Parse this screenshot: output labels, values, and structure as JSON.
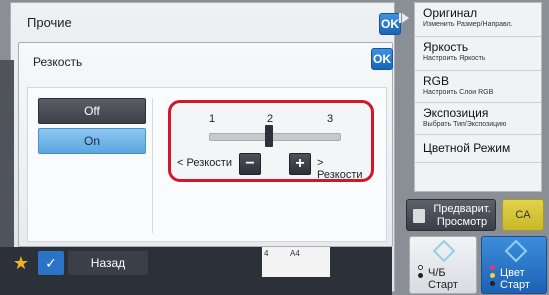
{
  "outer": {
    "title": "Прочие",
    "ok_label": "OK"
  },
  "dialog": {
    "title": "Резкость",
    "ok_label": "OK"
  },
  "options": {
    "off_label": "Off",
    "on_label": "On",
    "selected": "On"
  },
  "sharpness": {
    "ticks": [
      "1",
      "2",
      "3"
    ],
    "value": 2,
    "less_label": "< Резкости",
    "more_label": "> Резкости",
    "minus_label": "−",
    "plus_label": "+"
  },
  "sidebar": {
    "items": [
      {
        "label": "Оригинал",
        "sub": "Изменить Размер/Направл."
      },
      {
        "label": "Яркость",
        "sub": "Настроить Яркость"
      },
      {
        "label": "RGB",
        "sub": "Настроить Слои RGB"
      },
      {
        "label": "Экспозиция",
        "sub": "Выбрать Тип/Экспозицию"
      },
      {
        "label": "Цветной Режим",
        "sub": ""
      }
    ]
  },
  "preview": {
    "label": "Предварит. Просмотр"
  },
  "ca": {
    "label": "CA"
  },
  "start_bw": {
    "line1": "Ч/Б",
    "line2": "Старт"
  },
  "start_color": {
    "line1": "Цвет",
    "line2": "Старт"
  },
  "bottom": {
    "back_label": "Назад",
    "paper_a": "4",
    "paper_b": "A4"
  },
  "colors": {
    "accent": "#2b73c6",
    "highlight": "#d4162a",
    "ca": "#d8c63a"
  }
}
